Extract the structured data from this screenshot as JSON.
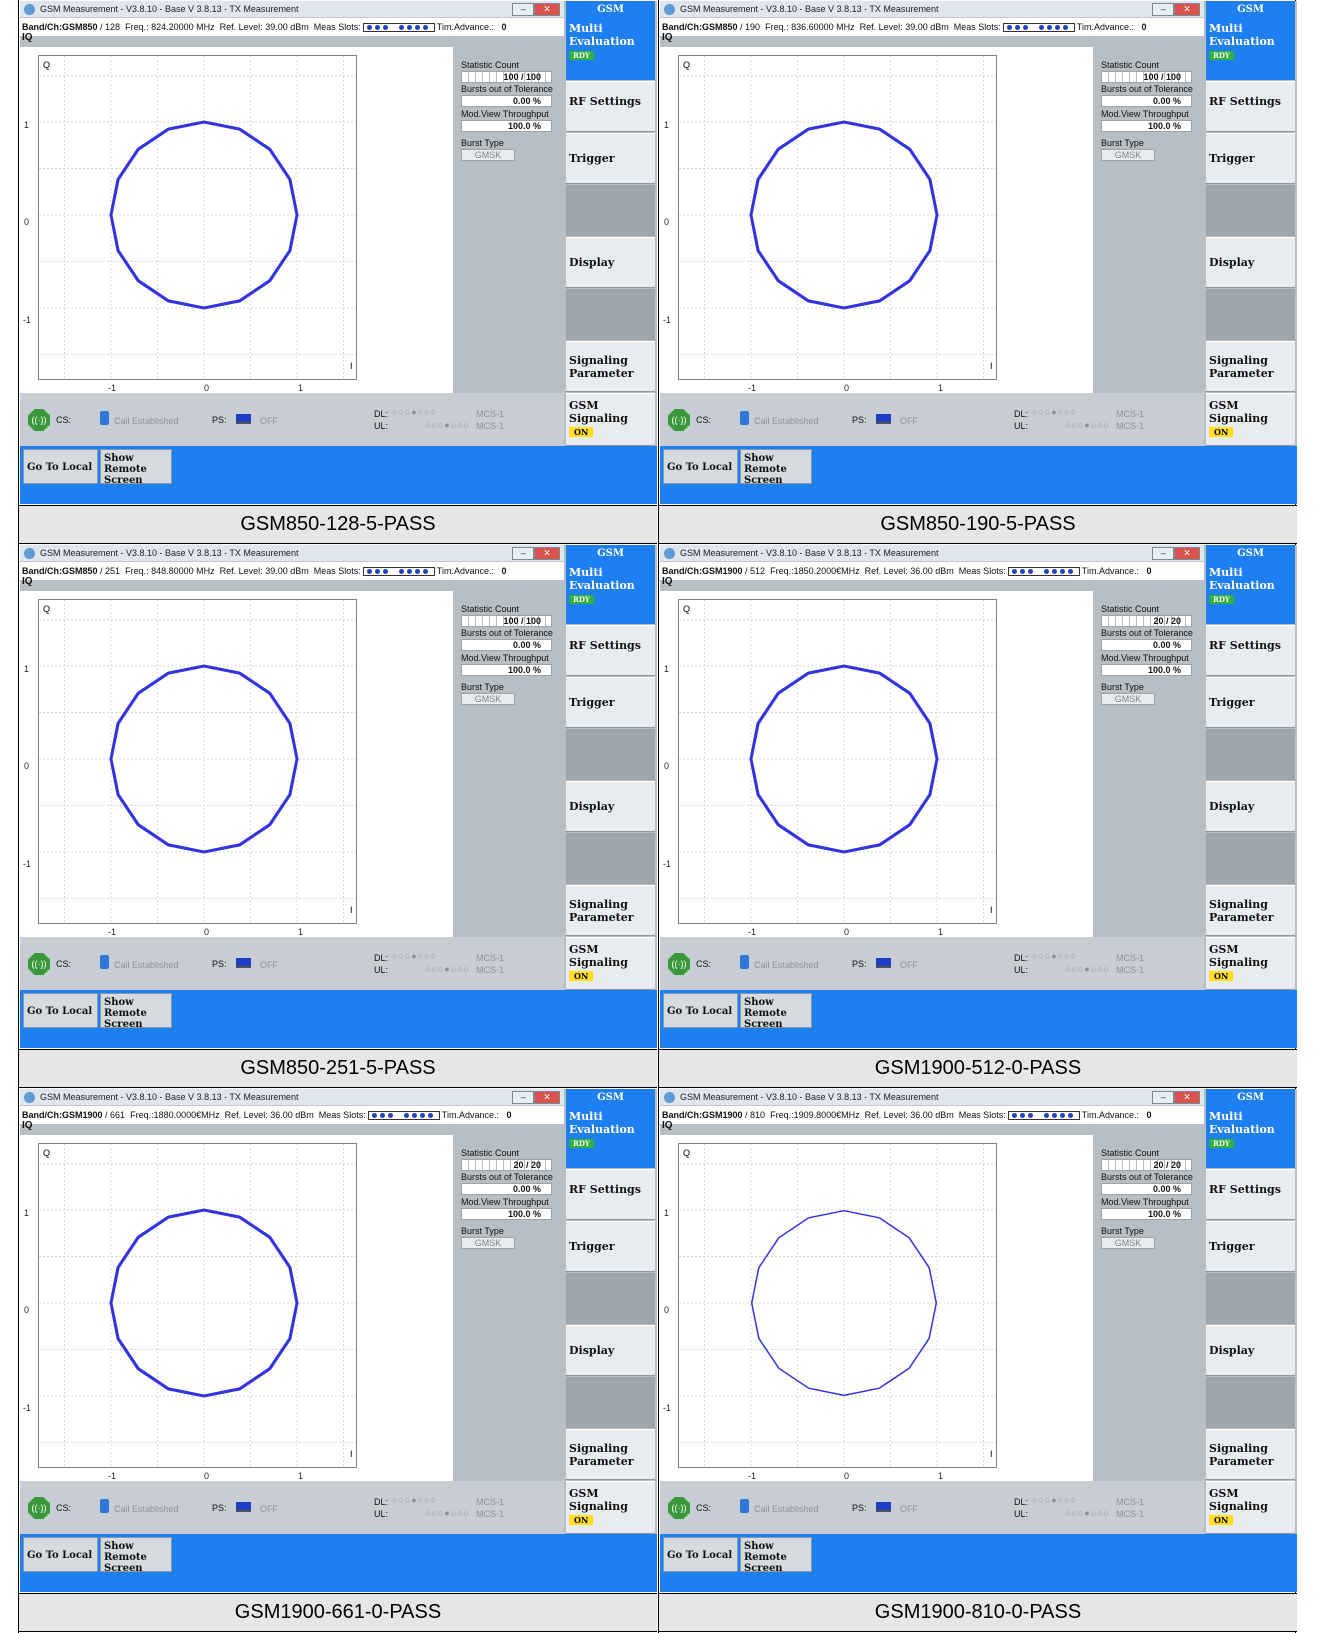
{
  "window": {
    "title": "GSM Measurement  - V3.8.10 - Base V 3.8.13 - TX Measurement",
    "minimize_icon": "minimize-icon",
    "close_icon": "close-icon"
  },
  "labels": {
    "iq": "IQ",
    "q_axis": "Q",
    "yticks": [
      "1",
      "0",
      "-1"
    ],
    "xticks": [
      "-1",
      "0",
      "1"
    ],
    "i_axis": "I",
    "ref_level": "Ref. Level:",
    "meas_slots": "Meas Slots:",
    "tim_advance": "Tim.Advance.:",
    "tim_advance_value": "0",
    "statistic_count": "Statistic Count",
    "bursts_out": "Bursts out of Tolerance",
    "throughput": "Mod.View Throughput",
    "burst_type": "Burst Type",
    "bursts_value": "0.00 %",
    "throughput_value": "100.0 %",
    "burst_type_value": "GMSK",
    "cs": "CS:",
    "call": "Call Established",
    "ps": "PS:",
    "ps_value": "OFF",
    "dl": "DL:",
    "ul": "UL:",
    "mcs_dl": "MCS-1",
    "mcs_ul": "MCS-1"
  },
  "softkeys": {
    "header": "GSM",
    "multi": "Multi Evaluation",
    "rdy": "RDY",
    "rf": "RF Settings",
    "trigger": "Trigger",
    "display": "Display",
    "signaling_param": "Signaling Parameter",
    "gsm_signaling": "GSM Signaling",
    "on": "ON"
  },
  "buttons": {
    "go_local": "Go To Local",
    "show_remote": "Show Remote Screen"
  },
  "panels": [
    {
      "band": "Band/Ch:GSM850",
      "ch": "/  128",
      "freq": "Freq.: 824.20000 MHz",
      "ref": "39.00 dBm",
      "count": "100 / 100",
      "caption": "GSM850-128-5-PASS"
    },
    {
      "band": "Band/Ch:GSM850",
      "ch": "/  190",
      "freq": "Freq.: 836.60000 MHz",
      "ref": "39.00 dBm",
      "count": "100 / 100",
      "caption": "GSM850-190-5-PASS"
    },
    {
      "band": "Band/Ch:GSM850",
      "ch": "/  251",
      "freq": "Freq.: 848.80000 MHz",
      "ref": "39.00 dBm",
      "count": "100 / 100",
      "caption": "GSM850-251-5-PASS"
    },
    {
      "band": "Band/Ch:GSM1900",
      "ch": "/  512",
      "freq": "Freq.:1850.2000€MHz",
      "ref": "36.00 dBm",
      "count": "20 / 20",
      "caption": "GSM1900-512-0-PASS"
    },
    {
      "band": "Band/Ch:GSM1900",
      "ch": "/  661",
      "freq": "Freq.:1880.0000€MHz",
      "ref": "36.00 dBm",
      "count": "20 / 20",
      "caption": "GSM1900-661-0-PASS"
    },
    {
      "band": "Band/Ch:GSM1900",
      "ch": "/  810",
      "freq": "Freq.:1909.8000€MHz",
      "ref": "36.00 dBm",
      "count": "20 / 20",
      "caption": "GSM1900-810-0-PASS"
    }
  ],
  "colors": {
    "trace": "#3333e0",
    "accent": "#1e7ff0",
    "rdy": "#30b040",
    "on": "#ffe01a"
  },
  "chart_data": {
    "type": "scatter",
    "description_axes": {
      "x": "I",
      "y": "Q"
    },
    "xlim": [
      -1.5,
      1.5
    ],
    "ylim": [
      -1.5,
      1.5
    ],
    "grid": true,
    "trace": "IQ constellation circle of radius 1"
  }
}
